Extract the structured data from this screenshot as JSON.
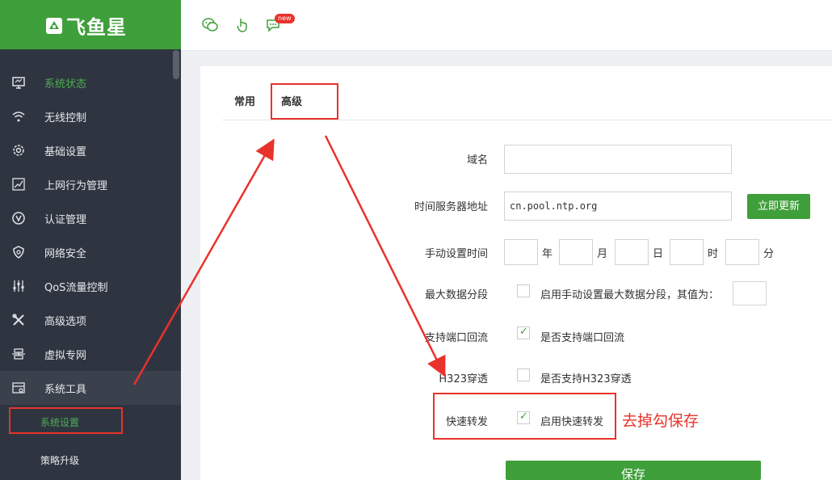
{
  "app": {
    "logo_text": "飞鱼星"
  },
  "sidebar": {
    "items": [
      {
        "label": "系统状态",
        "icon": "monitor-icon",
        "active": true
      },
      {
        "label": "无线控制",
        "icon": "wifi-icon"
      },
      {
        "label": "基础设置",
        "icon": "gear-icon"
      },
      {
        "label": "上网行为管理",
        "icon": "chart-line-icon"
      },
      {
        "label": "认证管理",
        "icon": "v-circle-icon"
      },
      {
        "label": "网络安全",
        "icon": "shield-icon"
      },
      {
        "label": "QoS流量控制",
        "icon": "sliders-icon"
      },
      {
        "label": "高级选项",
        "icon": "tools-icon"
      },
      {
        "label": "虚拟专网",
        "icon": "network-icon"
      },
      {
        "label": "系统工具",
        "icon": "system-tools-icon",
        "expanded": true
      }
    ],
    "subitems": [
      {
        "label": "系统设置",
        "active": true
      },
      {
        "label": "策略升级"
      }
    ]
  },
  "topbar": {
    "icons": [
      "wechat-icon",
      "touch-icon",
      "chat-icon"
    ],
    "badge": "new"
  },
  "tabs": [
    {
      "label": "常用"
    },
    {
      "label": "高级",
      "active": true
    }
  ],
  "form": {
    "domain_label": "域名",
    "domain_value": "",
    "ntp_label": "时间服务器地址",
    "ntp_value": "cn.pool.ntp.org",
    "update_button": "立即更新",
    "manual_time_label": "手动设置时间",
    "units": {
      "year": "年",
      "month": "月",
      "day": "日",
      "hour": "时",
      "minute": "分"
    },
    "mss_label": "最大数据分段",
    "mss_checkbox": "启用手动设置最大数据分段，其值为：",
    "mss_checked": false,
    "loopback_label": "支持端口回流",
    "loopback_checkbox": "是否支持端口回流",
    "loopback_checked": true,
    "h323_label": "H323穿透",
    "h323_checkbox": "是否支持H323穿透",
    "h323_checked": false,
    "fast_label": "快速转发",
    "fast_checkbox": "启用快速转发",
    "fast_checked": true,
    "save_button": "保存"
  },
  "annotation": {
    "text": "去掉勾保存",
    "color": "#e8322b"
  },
  "colors": {
    "brand": "#3f9f3a",
    "sidebar_bg": "#2f3540",
    "active_text": "#4caf50",
    "annotation": "#e8322b"
  }
}
